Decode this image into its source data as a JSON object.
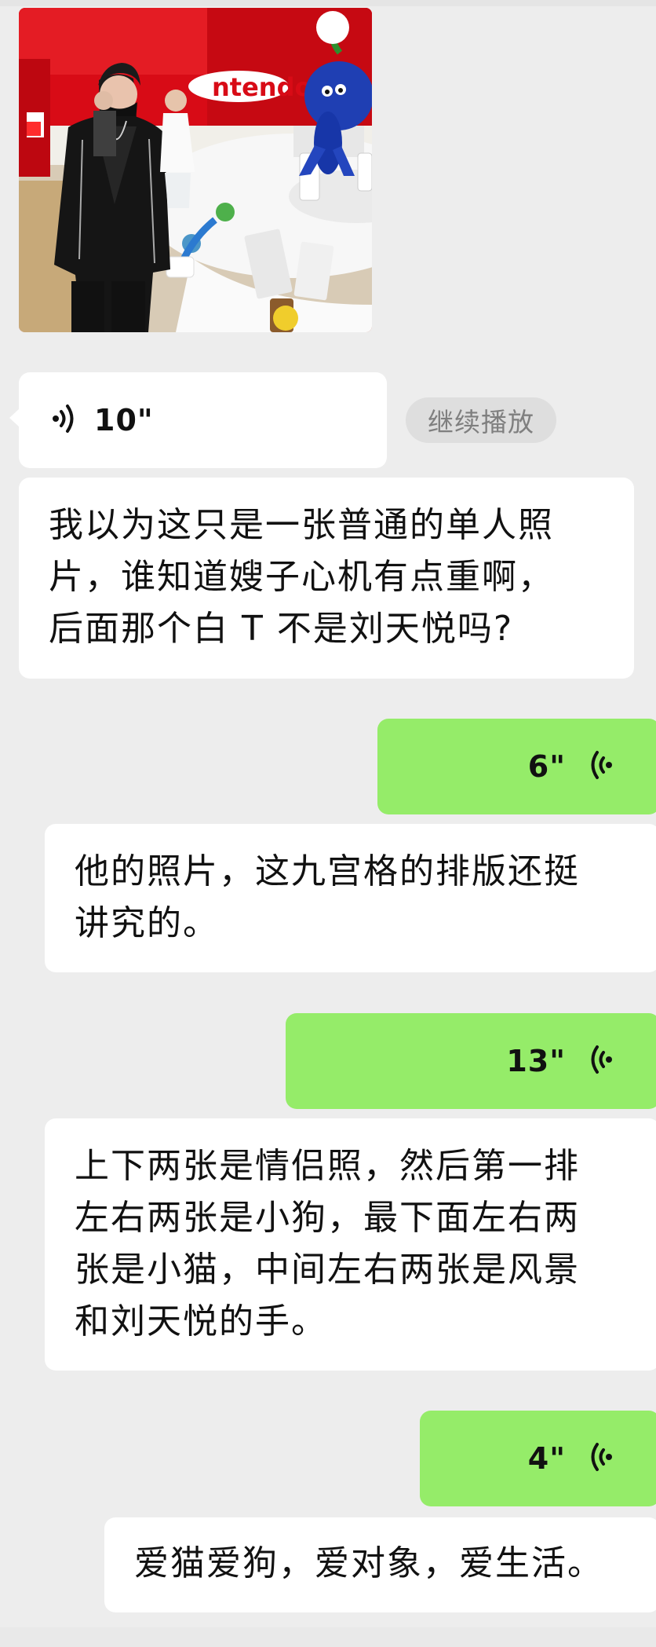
{
  "chat": {
    "photo": {
      "store_sign": "ntendo"
    },
    "voice_in": {
      "duration": "10\"",
      "icon": "voice-wave-icon"
    },
    "continue_label": "继续播放",
    "messages": [
      {
        "line1": "我以为这只是一张普通的单人照",
        "line2": "片，谁知道嫂子心机有点重啊，",
        "line3": "后面那个白 T 不是刘天悦吗?"
      },
      {
        "line1": "他的照片，这九宫格的排版还挺",
        "line2": "讲究的。"
      },
      {
        "line1": "上下两张是情侣照，然后第一排",
        "line2": "左右两张是小狗，最下面左右两",
        "line3": "张是小猫，中间左右两张是风景",
        "line4": "和刘天悦的手。"
      },
      {
        "line1": "爱猫爱狗，爱对象，爱生活。"
      }
    ],
    "voice_out": [
      {
        "duration": "6\"",
        "icon": "voice-wave-icon"
      },
      {
        "duration": "13\"",
        "icon": "voice-wave-icon"
      },
      {
        "duration": "4\"",
        "icon": "voice-wave-icon"
      }
    ]
  },
  "colors": {
    "background": "#ededed",
    "incoming_bubble": "#ffffff",
    "outgoing_bubble": "#95ec69",
    "nintendo_red": "#d80b16"
  }
}
